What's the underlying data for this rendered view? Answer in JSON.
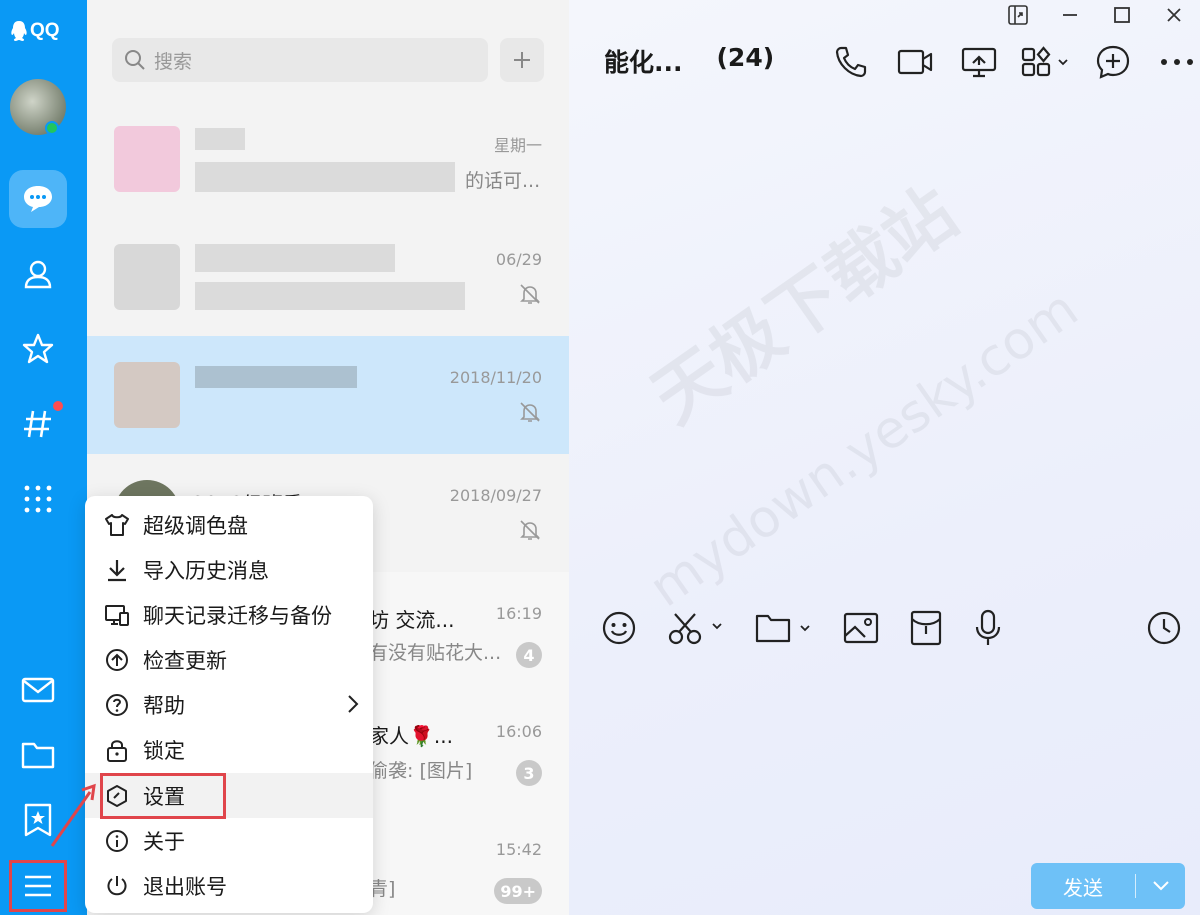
{
  "app": {
    "brand": "QQ",
    "accent": "#0A99F5",
    "highlight_color": "#E0454B"
  },
  "search": {
    "placeholder": "搜索"
  },
  "conversations": [
    {
      "time": "星期一",
      "preview_tail": "的话可...",
      "muted": false
    },
    {
      "time": "06/29",
      "muted": true
    },
    {
      "time": "2018/11/20",
      "muted": true,
      "selected": true
    },
    {
      "name": "2018级班委",
      "time": "2018/09/27",
      "muted": true
    },
    {
      "name_tail": "坊 交流...",
      "preview_tail": "有没有贴花大...",
      "time": "16:19",
      "badge": "4"
    },
    {
      "name_tail": "家人🌹...",
      "preview_tail": "偷袭: [图片]",
      "time": "16:06",
      "badge": "3"
    },
    {
      "preview_tail": "青]",
      "time": "15:42",
      "badge": "99+"
    }
  ],
  "chat": {
    "title": "能化...",
    "count": "(24)",
    "send_label": "发送"
  },
  "menu": {
    "items": [
      {
        "label": "超级调色盘",
        "icon": "shirt-icon"
      },
      {
        "label": "导入历史消息",
        "icon": "download-icon"
      },
      {
        "label": "聊天记录迁移与备份",
        "icon": "device-transfer-icon"
      },
      {
        "label": "检查更新",
        "icon": "upgrade-icon"
      },
      {
        "label": "帮助",
        "icon": "help-icon"
      },
      {
        "label": "锁定",
        "icon": "lock-icon"
      },
      {
        "label": "设置",
        "icon": "settings-icon"
      },
      {
        "label": "关于",
        "icon": "info-icon"
      },
      {
        "label": "退出账号",
        "icon": "power-icon"
      }
    ]
  },
  "watermark": {
    "cn": "天极下载站",
    "url": "mydown.yesky.com"
  }
}
